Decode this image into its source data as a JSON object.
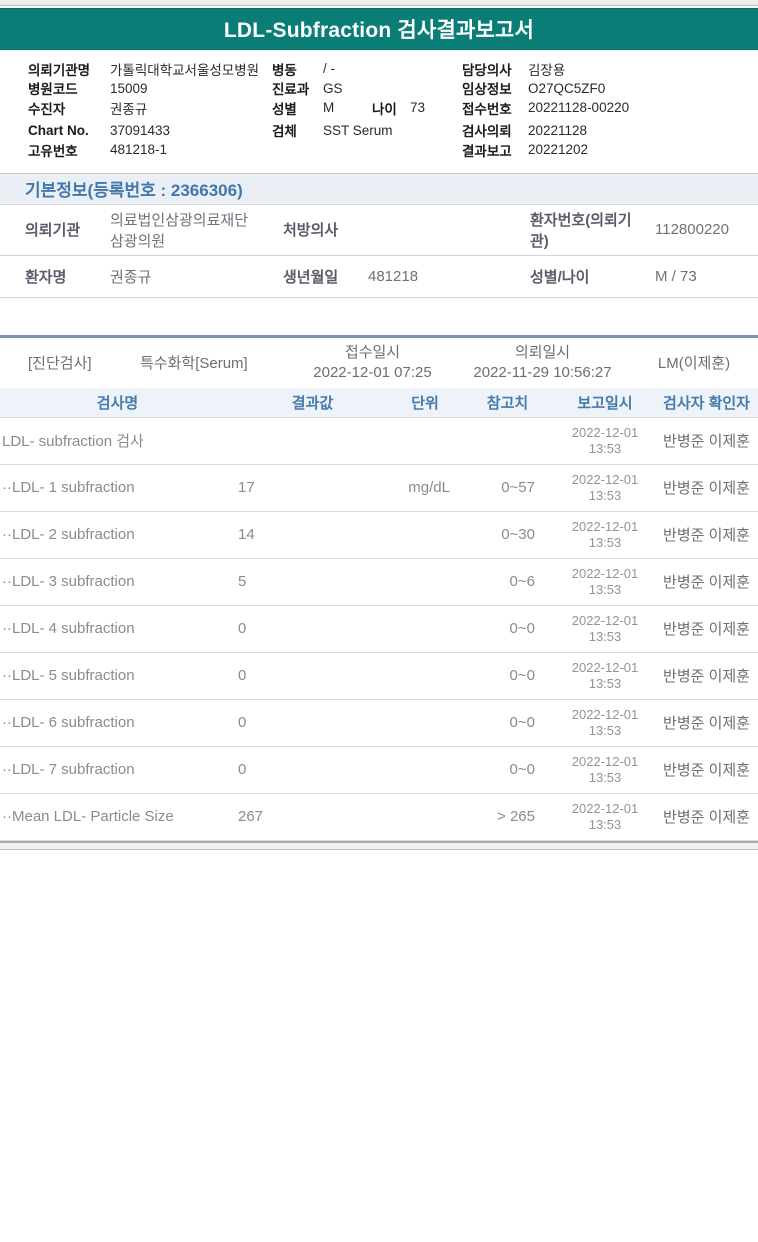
{
  "banner": {
    "title": "LDL-Subfraction 검사결과보고서"
  },
  "header_info": {
    "left": [
      {
        "label": "의뢰기관명",
        "value": "가톨릭대학교서울성모병원"
      },
      {
        "label": "병원코드",
        "value": "15009"
      },
      {
        "label": "수진자",
        "value": "권종규"
      },
      {
        "label": "Chart No.",
        "value": "37091433"
      },
      {
        "label": "고유번호",
        "value": "481218-1"
      }
    ],
    "middle": [
      {
        "label": "병동",
        "value": "/ -"
      },
      {
        "label": "진료과",
        "value": "GS"
      },
      {
        "label": "성별",
        "value": "M",
        "label2": "나이",
        "value2": "73"
      },
      {
        "label": "검체",
        "value": "SST Serum"
      }
    ],
    "right": [
      {
        "label": "담당의사",
        "value": "김장용"
      },
      {
        "label": "임상정보",
        "value": "O27QC5ZF0"
      },
      {
        "label": "접수번호",
        "value": "20221128-00220"
      },
      {
        "label": "검사의뢰",
        "value": "20221128"
      },
      {
        "label": "결과보고",
        "value": "20221202"
      }
    ]
  },
  "basic_info": {
    "section_title": "기본정보(등록번호 : 2366306)",
    "rows": [
      {
        "l1": "의뢰기관",
        "v1": "의료법인삼광의료재단삼광의원",
        "l2": "처방의사",
        "v2": "",
        "l3": "환자번호(의뢰기관)",
        "v3": "112800220"
      },
      {
        "l1": "환자명",
        "v1": "권종규",
        "l2": "생년월일",
        "v2": "481218",
        "l3": "성별/나이",
        "v3": "M / 73"
      }
    ]
  },
  "exam_section": {
    "category": "[진단검사]",
    "panel": "특수화학[Serum]",
    "receipt_label": "접수일시",
    "receipt_datetime": "2022-12-01 07:25",
    "request_label": "의뢰일시",
    "request_datetime": "2022-11-29 10:56:27",
    "lab_sign": "LM(이제훈)"
  },
  "results_table": {
    "headers": {
      "name": "검사명",
      "result": "결과값",
      "unit": "단위",
      "ref": "참고치",
      "reported": "보고일시",
      "staff": "검사자 확인자"
    },
    "rows": [
      {
        "name": "LDL- subfraction 검사",
        "result": "",
        "unit": "",
        "ref": "",
        "date": "2022-12-01",
        "time": "13:53",
        "staff": "반병준 이제훈"
      },
      {
        "name": "··LDL- 1 subfraction",
        "result": "17",
        "unit": "mg/dL",
        "ref": "0~57",
        "date": "2022-12-01",
        "time": "13:53",
        "staff": "반병준 이제훈"
      },
      {
        "name": "··LDL- 2 subfraction",
        "result": "14",
        "unit": "",
        "ref": "0~30",
        "date": "2022-12-01",
        "time": "13:53",
        "staff": "반병준 이제훈"
      },
      {
        "name": "··LDL- 3 subfraction",
        "result": "5",
        "unit": "",
        "ref": "0~6",
        "date": "2022-12-01",
        "time": "13:53",
        "staff": "반병준 이제훈"
      },
      {
        "name": "··LDL- 4 subfraction",
        "result": "0",
        "unit": "",
        "ref": "0~0",
        "date": "2022-12-01",
        "time": "13:53",
        "staff": "반병준 이제훈"
      },
      {
        "name": "··LDL- 5 subfraction",
        "result": "0",
        "unit": "",
        "ref": "0~0",
        "date": "2022-12-01",
        "time": "13:53",
        "staff": "반병준 이제훈"
      },
      {
        "name": "··LDL- 6 subfraction",
        "result": "0",
        "unit": "",
        "ref": "0~0",
        "date": "2022-12-01",
        "time": "13:53",
        "staff": "반병준 이제훈"
      },
      {
        "name": "··LDL- 7 subfraction",
        "result": "0",
        "unit": "",
        "ref": "0~0",
        "date": "2022-12-01",
        "time": "13:53",
        "staff": "반병준 이제훈"
      },
      {
        "name": "··Mean LDL- Particle Size",
        "result": "267",
        "unit": "",
        "ref": "> 265",
        "date": "2022-12-01",
        "time": "13:53",
        "staff": "반병준 이제훈"
      }
    ]
  },
  "colors": {
    "teal": "#0a7d76",
    "section_blue": "#4377ac",
    "table_header_blue": "#4679ad",
    "steel_border": "#7795b5"
  }
}
